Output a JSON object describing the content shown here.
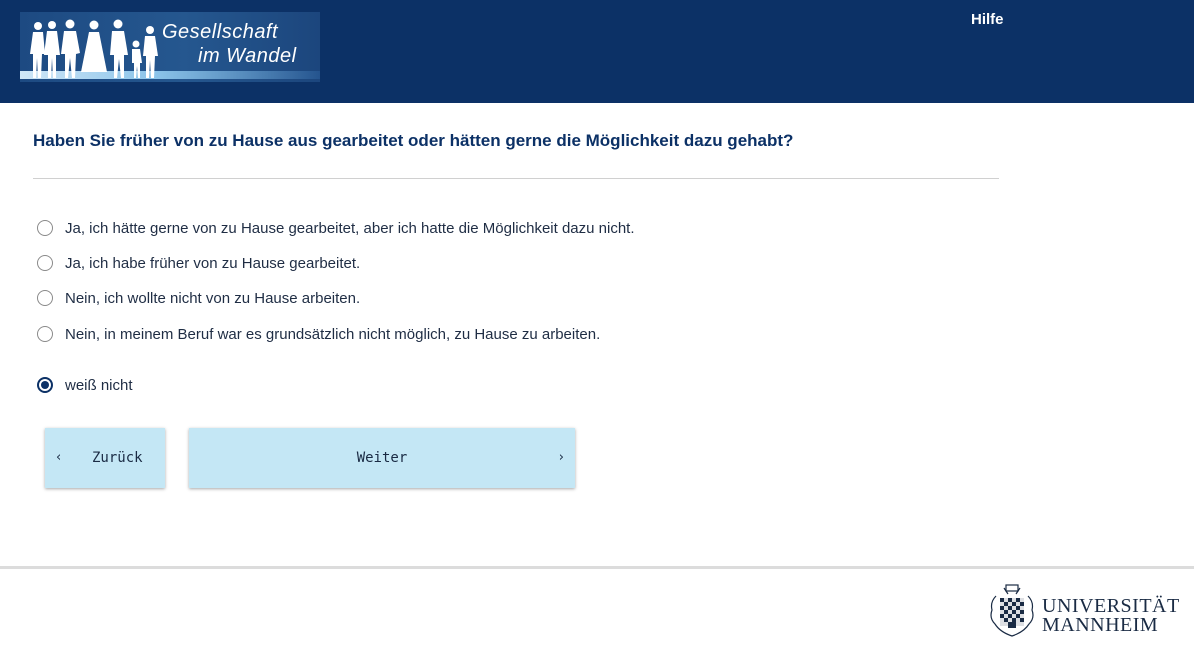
{
  "header": {
    "logo_line1": "Gesellschaft",
    "logo_line2": "im Wandel",
    "help_label": "Hilfe"
  },
  "question": {
    "text": "Haben Sie früher von zu Hause aus gearbeitet oder hätten gerne die Möglichkeit dazu gehabt?"
  },
  "options": [
    {
      "label": "Ja, ich hätte gerne von zu Hause gearbeitet, aber ich hatte die Möglichkeit dazu nicht.",
      "selected": false
    },
    {
      "label": "Ja, ich habe früher von zu Hause gearbeitet.",
      "selected": false
    },
    {
      "label": "Nein, ich wollte nicht von zu Hause arbeiten.",
      "selected": false
    },
    {
      "label": "Nein, in meinem Beruf war es grundsätzlich nicht möglich, zu Hause zu arbeiten.",
      "selected": false
    },
    {
      "label": "weiß nicht",
      "selected": true
    }
  ],
  "nav": {
    "back_label": "Zurück",
    "next_label": "Weiter",
    "back_icon": "chevron-left-icon",
    "next_icon": "chevron-right-icon"
  },
  "footer": {
    "university_line1": "UNIVERSITÄT",
    "university_line2": "MANNHEIM"
  },
  "colors": {
    "header_bg": "#0c3166",
    "question_text": "#0c3166",
    "button_bg": "#c4e7f5",
    "radio_selected": "#0c3166"
  }
}
